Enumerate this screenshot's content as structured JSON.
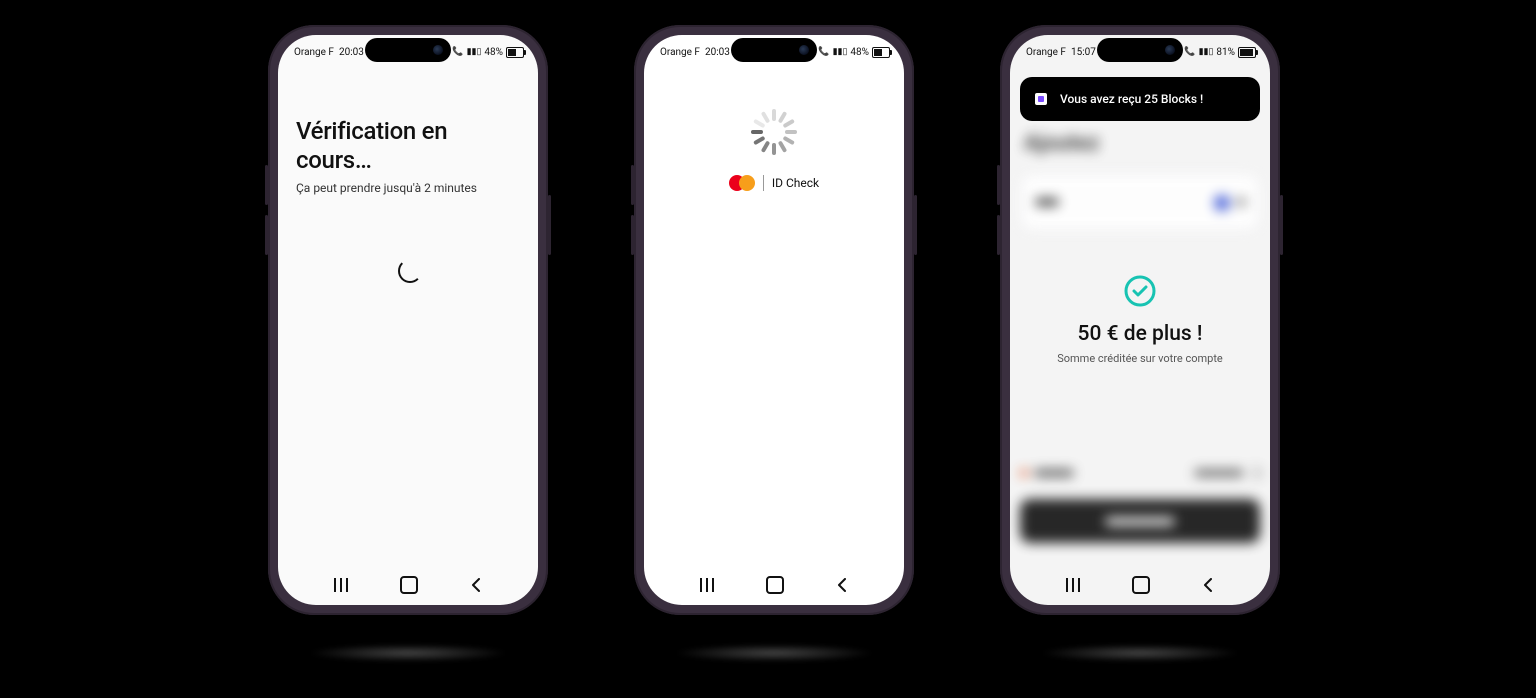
{
  "statusbar_a": {
    "carrier": "Orange F",
    "time": "20:03",
    "battery": "48%"
  },
  "statusbar_b": {
    "carrier": "Orange F",
    "time": "15:07",
    "battery": "81%"
  },
  "screen1": {
    "title": "Vérification en cours…",
    "subtitle": "Ça peut prendre jusqu'à 2 minutes"
  },
  "screen2": {
    "brand": "ID Check"
  },
  "screen3": {
    "toast": "Vous avez reçu 25 Blocks !",
    "headline": "50 € de plus !",
    "subline": "Somme créditée sur votre compte"
  }
}
